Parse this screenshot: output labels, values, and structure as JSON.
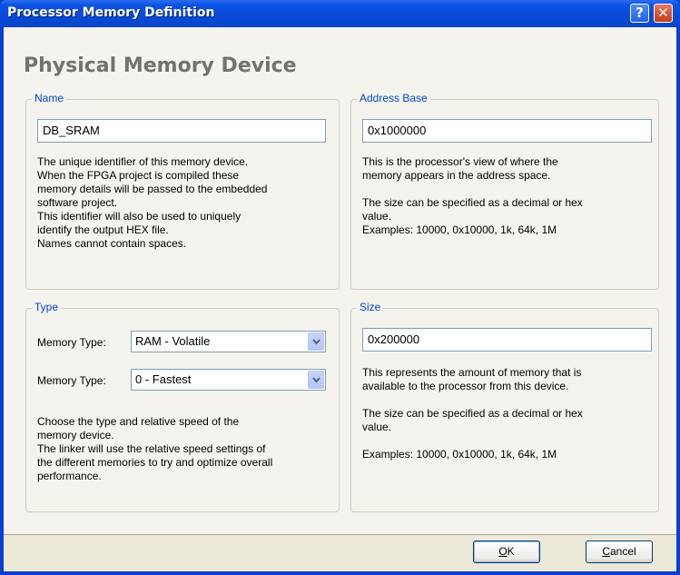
{
  "window": {
    "title": "Processor Memory Definition",
    "help_glyph": "?",
    "close_glyph": "✕"
  },
  "page_title": "Physical Memory Device",
  "name_group": {
    "title": "Name",
    "value": "DB_SRAM",
    "description": "The unique identifier of this memory device.\nWhen the FPGA project is compiled these\nmemory details will be passed to the embedded\nsoftware project.\nThis identifier will also be used to uniquely\nidentify the output HEX file.\nNames cannot contain spaces."
  },
  "address_group": {
    "title": "Address Base",
    "value": "0x1000000",
    "description1": "This is the processor's view of where the\nmemory appears in the address space.",
    "description2": "The size can be specified as a decimal or hex\nvalue.\nExamples: 10000, 0x10000, 1k, 64k, 1M"
  },
  "type_group": {
    "title": "Type",
    "memory_type_label_1": "Memory Type:",
    "memory_type_value_1": "RAM - Volatile",
    "memory_type_label_2": "Memory Type:",
    "memory_type_value_2": "0 - Fastest",
    "description": "Choose the type and relative speed of the\nmemory device.\nThe linker will use the relative speed settings of\nthe different memories to try and optimize overall\nperformance."
  },
  "size_group": {
    "title": "Size",
    "value": "0x200000",
    "description1": "This represents the amount of memory that is\navailable to the processor from this device.",
    "description2": "The size can be specified as a decimal or hex\nvalue.",
    "description3": "Examples: 10000, 0x10000, 1k, 64k, 1M"
  },
  "buttons": {
    "ok_accel": "O",
    "ok_rest": "K",
    "cancel_accel": "C",
    "cancel_rest": "ancel"
  },
  "colors": {
    "title_bar": "#0a52e2",
    "group_title": "#0046d5",
    "page_title": "#75726d"
  }
}
